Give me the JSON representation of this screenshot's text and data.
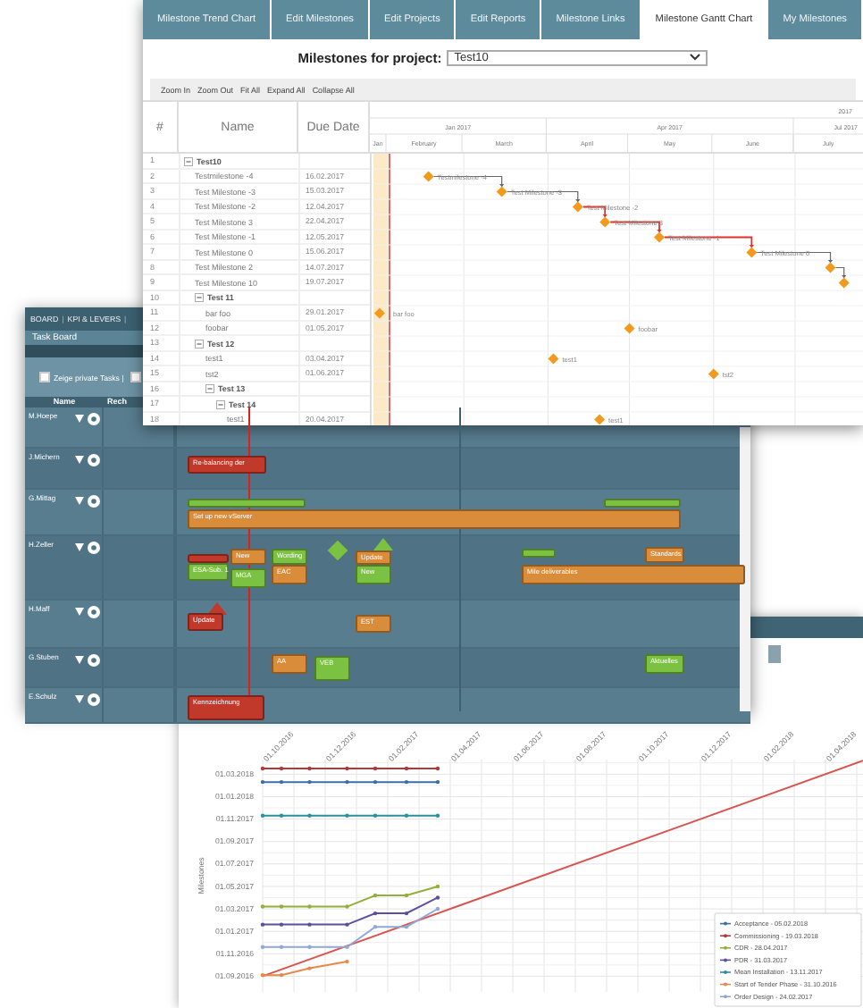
{
  "gantt_window": {
    "tabs": [
      {
        "label": "Milestone Trend Chart",
        "selected": false
      },
      {
        "label": "Edit Milestones",
        "selected": false
      },
      {
        "label": "Edit Projects",
        "selected": false
      },
      {
        "label": "Edit Reports",
        "selected": false
      },
      {
        "label": "Milestone Links",
        "selected": false
      },
      {
        "label": "Milestone Gantt Chart",
        "selected": true
      },
      {
        "label": "My Milestones",
        "selected": false
      }
    ],
    "project_label": "Milestones for project:",
    "project_select": {
      "value": "Test10"
    },
    "toolbar": [
      "Zoom In",
      "Zoom Out",
      "Fit All",
      "Expand All",
      "Collapse All"
    ],
    "columns": [
      "#",
      "Name",
      "Due Date"
    ],
    "timeline": {
      "year": "2017",
      "quarters": [
        "Jan 2017",
        "Apr 2017",
        "Jul 2017"
      ],
      "months": [
        "Jan",
        "February",
        "March",
        "April",
        "May",
        "June",
        "July"
      ]
    },
    "rows": [
      {
        "num": "1",
        "name": "Test10",
        "expanded": true,
        "children": [
          {
            "num": "2",
            "name": "Testmilestone -4",
            "due": "16.02.2017",
            "chart_label": "Testmilestone -4",
            "critical": false
          },
          {
            "num": "3",
            "name": "Test Milestone -3",
            "due": "15.03.2017",
            "chart_label": "Test Milestone -3",
            "critical": false
          },
          {
            "num": "4",
            "name": "Test Milestone -2",
            "due": "12.04.2017",
            "chart_label": "Test Milestone -2",
            "critical": false
          },
          {
            "num": "5",
            "name": "Test Milestone 3",
            "due": "22.04.2017",
            "chart_label": "Test Milestone 3",
            "critical": true
          },
          {
            "num": "6",
            "name": "Test Milestone -1",
            "due": "12.05.2017",
            "chart_label": "Test Milestone -1",
            "critical": true
          },
          {
            "num": "7",
            "name": "Test Milestone 0",
            "due": "15.06.2017",
            "chart_label": "Test Milestone 0",
            "critical": true
          },
          {
            "num": "8",
            "name": "Test Milestone 2",
            "due": "14.07.2017",
            "critical": false
          },
          {
            "num": "9",
            "name": "Test Milestone 10",
            "due": "19.07.2017",
            "critical": false
          },
          {
            "num": "10",
            "name": "Test 11",
            "expanded": true,
            "children": [
              {
                "num": "11",
                "name": "bar foo",
                "due": "29.01.2017",
                "chart_label": "bar foo"
              },
              {
                "num": "12",
                "name": "foobar",
                "due": "01.05.2017",
                "chart_label": "foobar"
              }
            ]
          },
          {
            "num": "13",
            "name": "Test 12",
            "expanded": true,
            "children": [
              {
                "num": "14",
                "name": "test1",
                "due": "03.04.2017",
                "chart_label": "test1"
              },
              {
                "num": "15",
                "name": "tst2",
                "due": "01.06.2017",
                "chart_label": "tst2"
              },
              {
                "num": "16",
                "name": "Test 13",
                "expanded": true,
                "children": [
                  {
                    "num": "17",
                    "name": "Test 14",
                    "expanded": true,
                    "children": [
                      {
                        "num": "18",
                        "name": "test1",
                        "due": "20.04.2017",
                        "chart_label": "test1"
                      }
                    ]
                  }
                ]
              }
            ]
          }
        ]
      }
    ]
  },
  "task_board": {
    "nav": [
      {
        "kind": "link",
        "text": "BOARD"
      },
      {
        "kind": "sep",
        "text": "|"
      },
      {
        "kind": "link",
        "text": "KPI & LEVERS"
      },
      {
        "kind": "sep",
        "text": "|"
      }
    ],
    "title": "Task Board",
    "filters": [
      {
        "label": "Zeige private Tasks |",
        "checked": false
      },
      {
        "checked": false
      }
    ],
    "columns": [
      "Name",
      "Rech"
    ],
    "lanes": [
      {
        "name": "M.Hoepe"
      },
      {
        "name": "J.Michern",
        "tasks": [
          {
            "kind": "bar",
            "label": "Re-balancing der",
            "color": "#c0392b"
          }
        ]
      },
      {
        "name": "G.Mittag",
        "tasks": [
          {
            "kind": "bar",
            "color": "#7cc242"
          },
          {
            "kind": "bar",
            "color": "#7cc242"
          },
          {
            "kind": "bar",
            "label": "Set up new vServer",
            "color": "#d98c3a"
          }
        ]
      },
      {
        "name": "H.Zeller",
        "tasks": [
          {
            "kind": "bar",
            "color": "#c0392b"
          },
          {
            "kind": "bar",
            "label": "New",
            "color": "#d98c3a"
          },
          {
            "kind": "bar",
            "label": "Wording",
            "color": "#7cc242"
          },
          {
            "kind": "diamond",
            "color": "#7cc242"
          },
          {
            "kind": "triangle",
            "color": "#7cc242"
          },
          {
            "kind": "bar",
            "label": "Update",
            "color": "#d98c3a"
          },
          {
            "kind": "bar",
            "color": "#7cc242"
          },
          {
            "kind": "bar",
            "label": "Standards",
            "color": "#d98c3a"
          },
          {
            "kind": "bar",
            "label": "ESA-Sub. 1",
            "color": "#7cc242"
          },
          {
            "kind": "bar",
            "label": "MGA",
            "color": "#7cc242"
          },
          {
            "kind": "bar",
            "label": "EAC",
            "color": "#d98c3a"
          },
          {
            "kind": "bar",
            "label": "New",
            "color": "#7cc242"
          },
          {
            "kind": "bar",
            "label": "Mile deliverables",
            "color": "#d98c3a"
          }
        ]
      },
      {
        "name": "H.Maff",
        "tasks": [
          {
            "kind": "triangle",
            "color": "#c0392b"
          },
          {
            "kind": "bar",
            "label": "Update",
            "color": "#c0392b"
          },
          {
            "kind": "bar",
            "label": "EST",
            "color": "#d98c3a"
          }
        ]
      },
      {
        "name": "G.Stuben",
        "tasks": [
          {
            "kind": "bar",
            "label": "AA",
            "color": "#d98c3a"
          },
          {
            "kind": "bar",
            "label": "VEB",
            "color": "#7cc242"
          },
          {
            "kind": "bar",
            "label": "Aktuelles",
            "color": "#7cc242"
          }
        ]
      },
      {
        "name": "E.Schulz",
        "tasks": [
          {
            "kind": "bar",
            "label": "Kennzeichnung",
            "color": "#c0392b"
          }
        ]
      }
    ]
  },
  "trend_chart": {
    "y_axis_title": "Milestones",
    "x_axis_labels": [
      "01.10.2016",
      "01.12.2016",
      "01.02.2017",
      "01.04.2017",
      "01.06.2017",
      "01.08.2017",
      "01.10.2017",
      "01.12.2017",
      "01.02.2018",
      "01.04.2018"
    ],
    "y_axis_labels": [
      "01.03.2018",
      "01.01.2018",
      "01.11.2017",
      "01.09.2017",
      "01.07.2017",
      "01.05.2017",
      "01.03.2017",
      "01.01.2017",
      "01.11.2016",
      "01.09.2016"
    ],
    "legend": [
      {
        "text": "Acceptance - 05.02.2018",
        "color": "#3c6fa5"
      },
      {
        "text": "Commissioning - 19.03.2018",
        "color": "#b03a3a"
      },
      {
        "text": "CDR - 28.04.2017",
        "color": "#8fb03a"
      },
      {
        "text": "PDR - 31.03.2017",
        "color": "#5b4f9e"
      },
      {
        "text": "Mean Installation - 13.11.2017",
        "color": "#2b8fa0"
      },
      {
        "text": "Start of Tender Phase - 31.10.2016",
        "color": "#e8874a"
      },
      {
        "text": "Order Design - 24.02.2017",
        "color": "#8fa8d8"
      }
    ]
  }
}
